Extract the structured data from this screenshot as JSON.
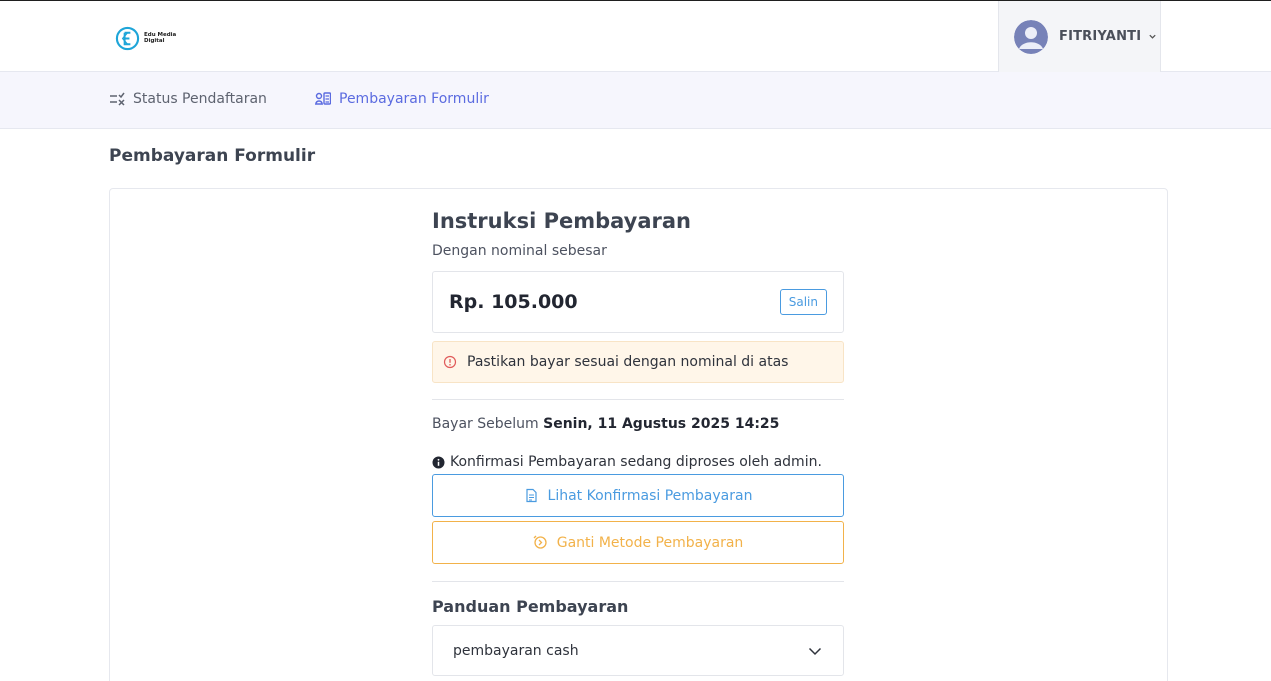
{
  "brand": {
    "logo_line1": "Edu Media",
    "logo_line2": "Digital",
    "accent_color": "#1ea5d8"
  },
  "user": {
    "name": "FITRIYANTI",
    "avatar_icon": "user-avatar-icon",
    "menu_icon": "chevron-down-icon"
  },
  "nav": {
    "items": [
      {
        "label": "Status Pendaftaran",
        "icon": "checklist-icon",
        "active": false
      },
      {
        "label": "Pembayaran Formulir",
        "icon": "payment-form-icon",
        "active": true
      }
    ],
    "active_color": "#5b6be0"
  },
  "page": {
    "title": "Pembayaran Formulir"
  },
  "instructions": {
    "title": "Instruksi Pembayaran",
    "subtitle": "Dengan nominal sebesar",
    "amount": "Rp. 105.000",
    "copy_label": "Salin",
    "warning": "Pastikan bayar sesuai dengan nominal di atas",
    "deadline_label": "Bayar Sebelum",
    "deadline_value": "Senin, 11 Agustus 2025 14:25",
    "confirmation_notice": "Konfirmasi Pembayaran sedang diproses oleh admin.",
    "view_confirmation_label": "Lihat Konfirmasi Pembayaran",
    "change_method_label": "Ganti Metode Pembayaran"
  },
  "guide": {
    "title": "Panduan Pembayaran",
    "selected": "pembayaran cash"
  },
  "colors": {
    "info_blue": "#4a9be0",
    "warning_orange": "#f2b24a",
    "warning_bg": "#fff6e9",
    "error_red": "#e05a5a"
  }
}
